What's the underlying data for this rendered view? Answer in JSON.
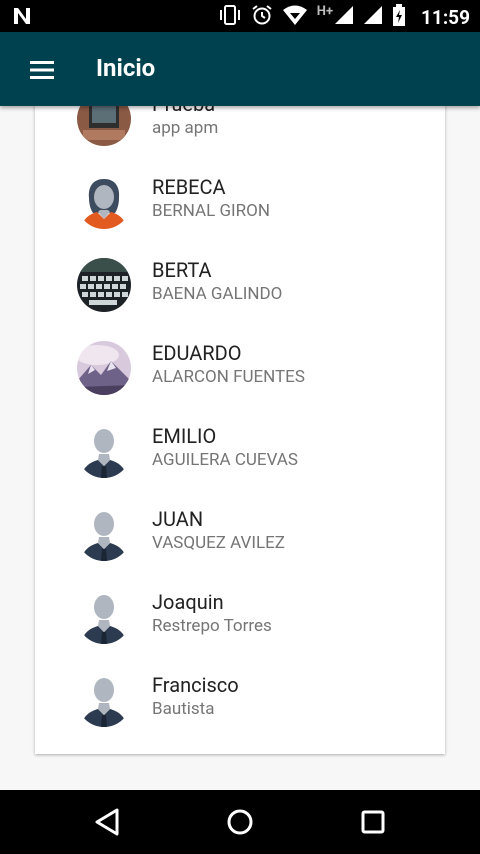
{
  "status_bar": {
    "time": "11:59",
    "network": "H+",
    "icons": [
      "notification-n-icon",
      "vibrate-icon",
      "alarm-icon",
      "wifi-icon",
      "signal-icon",
      "signal-icon",
      "battery-charging-icon"
    ]
  },
  "app_bar": {
    "title": "Inicio",
    "menu_icon": "hamburger-menu-icon",
    "color": "#00414f"
  },
  "contacts": [
    {
      "name": "Prueba",
      "subtitle": "app apm",
      "avatar": "photo-laptop"
    },
    {
      "name": "REBECA",
      "subtitle": "BERNAL GIRON",
      "avatar": "female-default"
    },
    {
      "name": "BERTA",
      "subtitle": "BAENA GALINDO",
      "avatar": "photo-keyboard"
    },
    {
      "name": "EDUARDO",
      "subtitle": "ALARCON FUENTES",
      "avatar": "photo-landscape"
    },
    {
      "name": "EMILIO",
      "subtitle": "AGUILERA CUEVAS",
      "avatar": "male-default"
    },
    {
      "name": "JUAN",
      "subtitle": "VASQUEZ AVILEZ",
      "avatar": "male-default"
    },
    {
      "name": "Joaquin",
      "subtitle": "Restrepo Torres",
      "avatar": "male-default"
    },
    {
      "name": "Francisco",
      "subtitle": "Bautista",
      "avatar": "male-default"
    }
  ],
  "nav_bar": {
    "back": "back-icon",
    "home": "home-icon",
    "recents": "recents-icon"
  }
}
